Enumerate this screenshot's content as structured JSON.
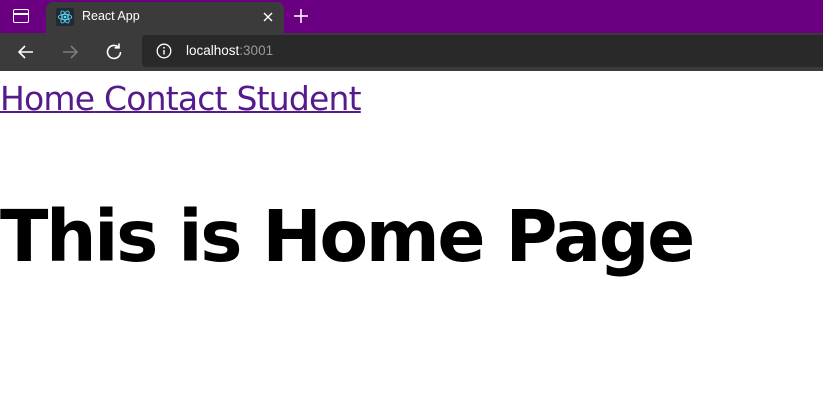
{
  "browser": {
    "tab": {
      "title": "React App",
      "favicon": "react-logo-icon"
    },
    "address_bar": {
      "host": "localhost",
      "port": ":3001"
    },
    "colors": {
      "tabstrip": "#6a0081",
      "toolbar": "#3b3b3b",
      "omnibox": "#292929"
    }
  },
  "page": {
    "nav": [
      {
        "label": "Home"
      },
      {
        "label": "Contact"
      },
      {
        "label": "Student"
      }
    ],
    "heading": "This is Home Page",
    "colors": {
      "link": "#551a8b",
      "heading": "#000000"
    }
  }
}
